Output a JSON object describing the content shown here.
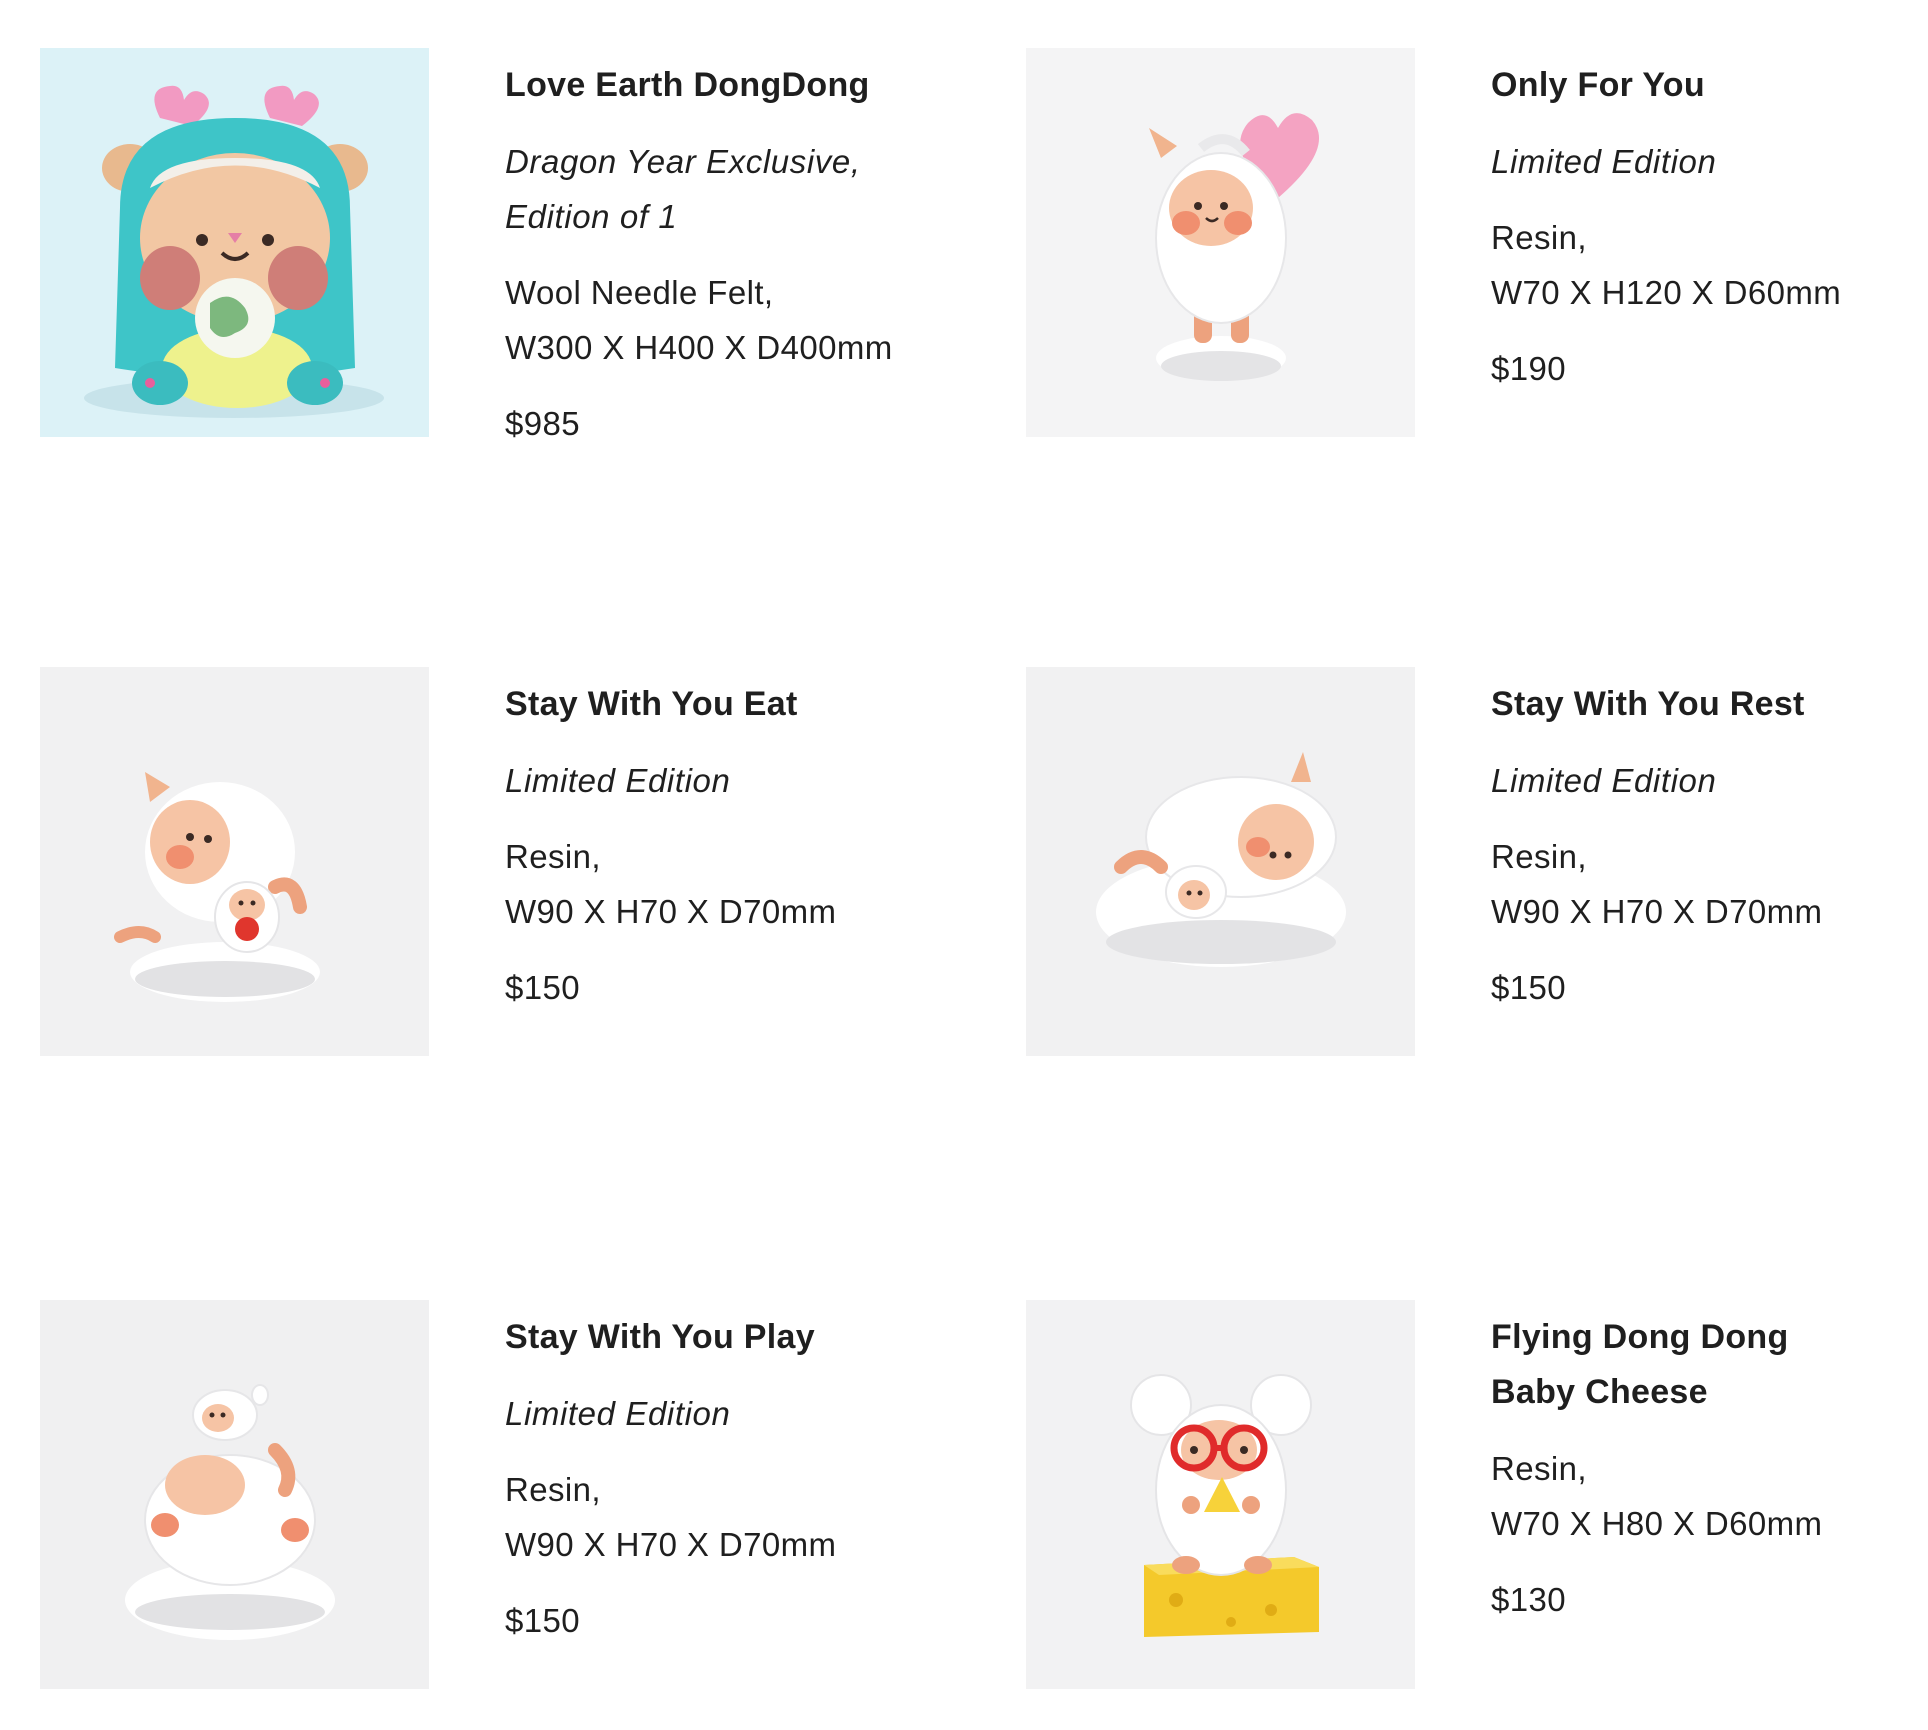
{
  "products": [
    {
      "title_lines": [
        "Love Earth DongDong"
      ],
      "subtitle_lines": [
        "Dragon Year Exclusive,",
        "Edition of 1"
      ],
      "material": "Wool Needle Felt,",
      "dimensions": "W300 X H400 X D400mm",
      "price": "$985",
      "image_bg": "#d9f1f6"
    },
    {
      "title_lines": [
        "Only For You"
      ],
      "subtitle_lines": [
        "Limited Edition"
      ],
      "material": "Resin,",
      "dimensions": "W70 X H120 X D60mm",
      "price": "$190",
      "image_bg": "#f3f3f4"
    },
    {
      "title_lines": [
        "Stay With You Eat"
      ],
      "subtitle_lines": [
        "Limited Edition"
      ],
      "material": "Resin,",
      "dimensions": "W90 X H70 X D70mm",
      "price": "$150",
      "image_bg": "#f1f1f2"
    },
    {
      "title_lines": [
        "Stay With You Rest"
      ],
      "subtitle_lines": [
        "Limited Edition"
      ],
      "material": "Resin,",
      "dimensions": "W90 X H70 X D70mm",
      "price": "$150",
      "image_bg": "#f1f1f2"
    },
    {
      "title_lines": [
        "Stay With You Play"
      ],
      "subtitle_lines": [
        "Limited Edition"
      ],
      "material": "Resin,",
      "dimensions": "W90 X H70 X D70mm",
      "price": "$150",
      "image_bg": "#f0f0f1"
    },
    {
      "title_lines": [
        "Flying Dong Dong",
        "Baby Cheese"
      ],
      "subtitle_lines": [],
      "material": "Resin,",
      "dimensions": "W70 X H80 X D60mm",
      "price": "$130",
      "image_bg": "#f2f2f3"
    }
  ]
}
